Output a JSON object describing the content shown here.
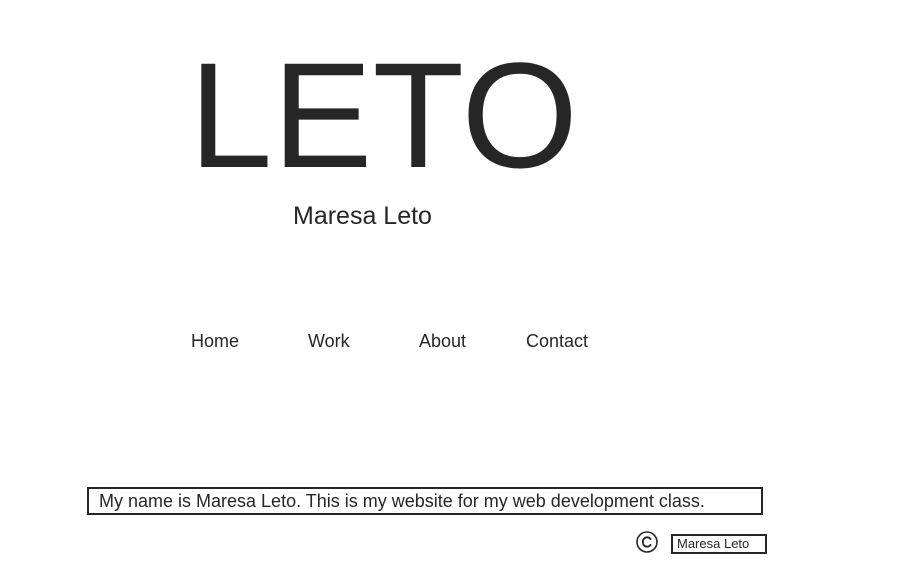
{
  "header": {
    "logo_text": "LETO",
    "subtitle": "Maresa Leto"
  },
  "nav": {
    "items": [
      {
        "label": "Home"
      },
      {
        "label": "Work"
      },
      {
        "label": "About"
      },
      {
        "label": "Contact"
      }
    ]
  },
  "main": {
    "bio": "My name is Maresa Leto. This is my website for my web development class."
  },
  "footer": {
    "copyright_icon": "copyright-icon",
    "name": "Maresa Leto"
  },
  "colors": {
    "text": "#262626",
    "background": "#ffffff",
    "border": "#262626"
  }
}
